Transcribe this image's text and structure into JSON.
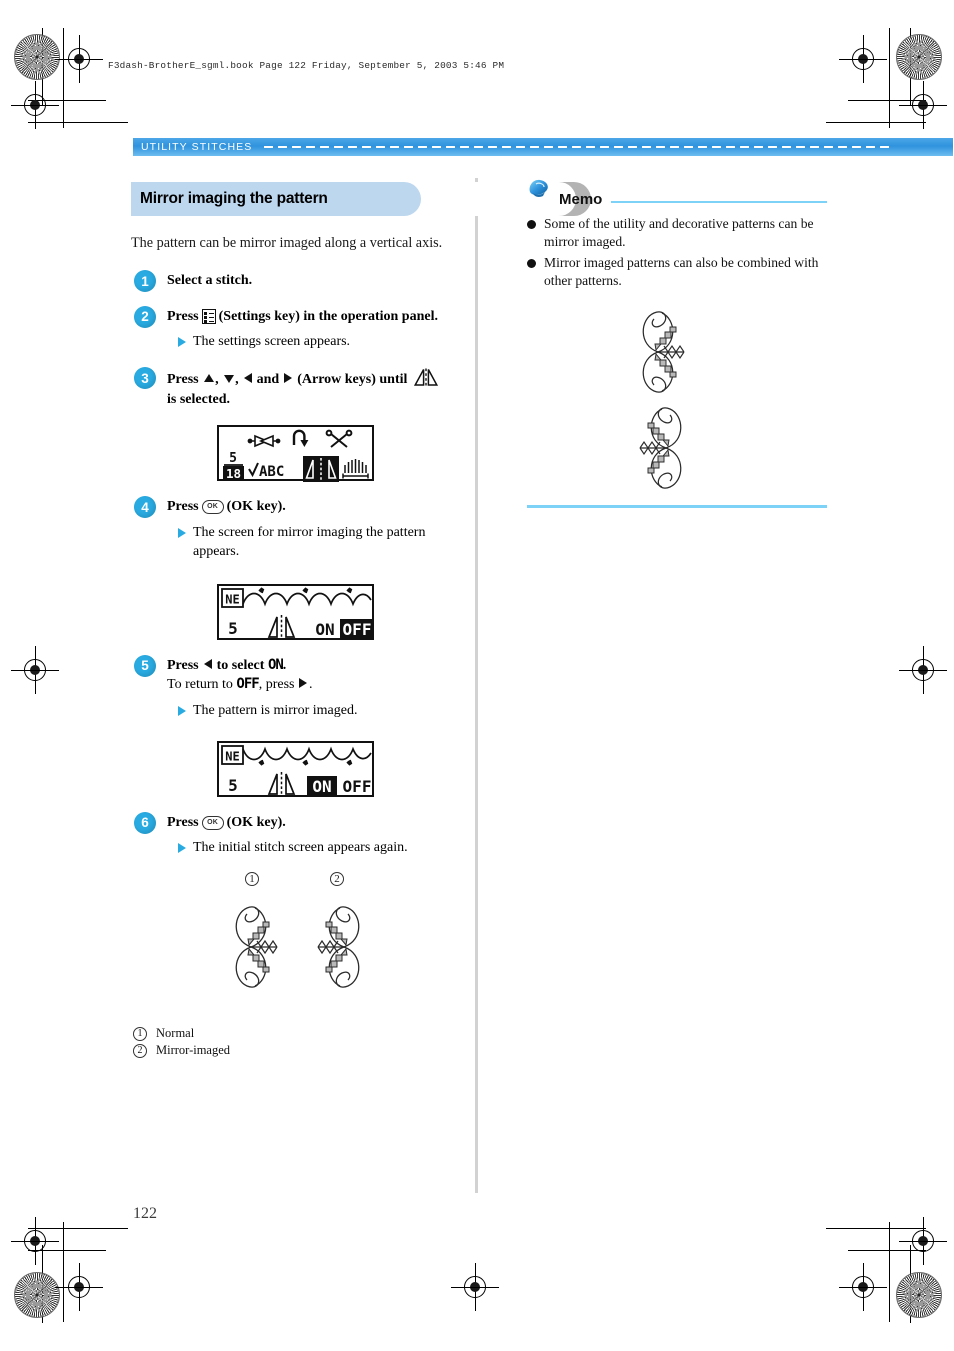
{
  "print_header": {
    "text": "F3dash-BrotherE_sgml.book   Page 122  Friday, September 5, 2003   5:46 PM"
  },
  "section_banner": {
    "label": "UTILITY STITCHES"
  },
  "page_number": "122",
  "left_column": {
    "title": "Mirror imaging the pattern",
    "intro": "The pattern can be mirror imaged along a vertical axis.",
    "steps": [
      {
        "num": "1",
        "title": "Select a stitch.",
        "substeps": []
      },
      {
        "num": "2",
        "title_pre": "Press",
        "icon": "settings-key-icon",
        "title_post": "(Settings key) in the operation panel.",
        "substeps": [
          "The settings screen appears."
        ]
      },
      {
        "num": "3",
        "title_pre": "Press",
        "arrow_keys_text": ", , and",
        "title_mid": "(Arrow keys) until",
        "icon": "mirror-icon",
        "title_post": "is selected.",
        "substeps": []
      },
      {
        "num": "4",
        "title_pre": "Press",
        "icon": "ok-key-icon",
        "title_post": "(OK key).",
        "substeps": [
          "The screen for mirror imaging the pattern appears."
        ]
      },
      {
        "num": "5",
        "line1_pre": "Press",
        "line1_mid": "to select",
        "line1_value": "ON",
        "line1_end": ".",
        "line2_pre": "To return to",
        "line2_value": "OFF",
        "line2_mid": ", press",
        "line2_end": ".",
        "substeps": [
          "The pattern is mirror imaged."
        ]
      },
      {
        "num": "6",
        "title_pre": "Press",
        "icon": "ok-key-icon",
        "title_post": "(OK key).",
        "substeps": [
          "The initial stitch screen appears again."
        ]
      }
    ],
    "lcd_screens": [
      {
        "name": "settings-screen",
        "page_indicator_top": "5",
        "page_indicator_bottom": "18",
        "label_abc": "ABC",
        "selected_item": "mirror-icon",
        "icons": [
          "thread-tension-icon",
          "needle-position-icon",
          "thread-cutter-icon",
          "abc-check-icon",
          "mirror-icon",
          "feed-icon"
        ]
      },
      {
        "name": "mirror-screen-off",
        "stitch_number": "5",
        "mode_label": "NE",
        "option_on": "ON",
        "option_off": "OFF",
        "selected": "OFF",
        "pattern": "normal"
      },
      {
        "name": "mirror-screen-on",
        "stitch_number": "5",
        "mode_label": "NE",
        "option_on": "ON",
        "option_off": "OFF",
        "selected": "ON",
        "pattern": "mirrored"
      }
    ],
    "compare_figure": {
      "callout_1": "1",
      "callout_2": "2",
      "legend": [
        {
          "num": "1",
          "label": "Normal"
        },
        {
          "num": "2",
          "label": "Mirror-imaged"
        }
      ]
    }
  },
  "right_column": {
    "memo": {
      "title": "Memo",
      "items": [
        "Some of the utility and decorative patterns can be mirror imaged.",
        "Mirror imaged patterns can also be combined with other patterns."
      ],
      "figure_name": "combined-mirror-pattern-illustration"
    }
  },
  "colors": {
    "accent_blue": "#29abe2",
    "banner_blue": "#2f93dd",
    "title_pill": "#bdd7ee",
    "rule_blue": "#7dd3f7",
    "divider_gray": "#d2d2d2"
  }
}
